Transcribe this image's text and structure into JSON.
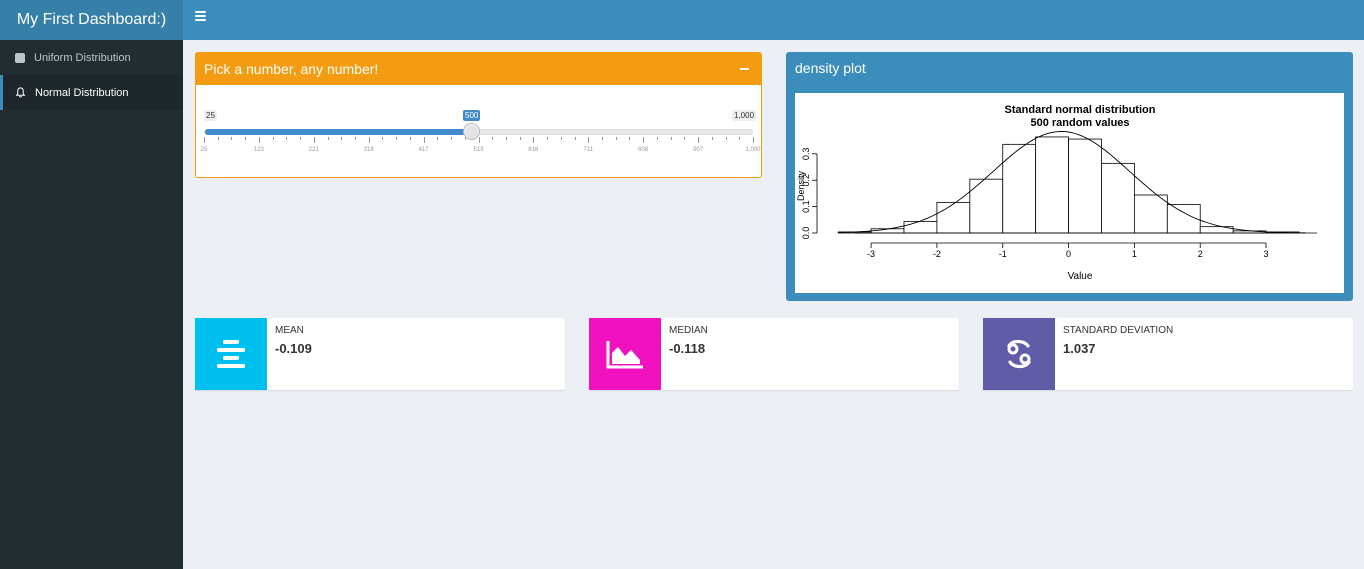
{
  "app": {
    "title": "My First Dashboard:)"
  },
  "sidebar": {
    "items": [
      {
        "label": "Uniform Distribution",
        "icon": "square-icon"
      },
      {
        "label": "Normal Distribution",
        "icon": "bell-icon"
      }
    ]
  },
  "slider_box": {
    "title": "Pick a number, any number!",
    "min_label": "25",
    "max_label": "1,000",
    "value_label": "500",
    "value": 500,
    "min": 25,
    "max": 1000,
    "tick_labels": [
      "25",
      "123",
      "221",
      "318",
      "417",
      "513",
      "616",
      "711",
      "808",
      "907",
      "1,000"
    ],
    "color": "#f39c12"
  },
  "plot_box": {
    "title": "density plot",
    "color": "#3c8dbc"
  },
  "chart_data": {
    "type": "bar",
    "title": "Standard normal distribution",
    "subtitle": "500 random values",
    "xlabel": "Value",
    "ylabel": "Density",
    "xlim": [
      -3.7,
      3.85
    ],
    "ylim": [
      0,
      0.36
    ],
    "x_ticks": [
      -3,
      -2,
      -1,
      0,
      1,
      2,
      3
    ],
    "y_ticks": [
      0.0,
      0.1,
      0.2,
      0.3
    ],
    "bins": [
      {
        "from": -3.5,
        "to": -3.0,
        "density": 0.004
      },
      {
        "from": -3.0,
        "to": -2.5,
        "density": 0.016
      },
      {
        "from": -2.5,
        "to": -2.0,
        "density": 0.044
      },
      {
        "from": -2.0,
        "to": -1.5,
        "density": 0.116
      },
      {
        "from": -1.5,
        "to": -1.0,
        "density": 0.204
      },
      {
        "from": -1.0,
        "to": -0.5,
        "density": 0.336
      },
      {
        "from": -0.5,
        "to": 0.0,
        "density": 0.364
      },
      {
        "from": 0.0,
        "to": 0.5,
        "density": 0.356
      },
      {
        "from": 0.5,
        "to": 1.0,
        "density": 0.264
      },
      {
        "from": 1.0,
        "to": 1.5,
        "density": 0.144
      },
      {
        "from": 1.5,
        "to": 2.0,
        "density": 0.108
      },
      {
        "from": 2.0,
        "to": 2.5,
        "density": 0.024
      },
      {
        "from": 2.5,
        "to": 3.0,
        "density": 0.008
      },
      {
        "from": 3.0,
        "to": 3.5,
        "density": 0.004
      }
    ],
    "density_curve": "normal, mean -0.109, sd 1.037"
  },
  "stats": [
    {
      "label": "MEAN",
      "value": "-0.109",
      "color": "#00c0ef",
      "icon": "align-center-icon"
    },
    {
      "label": "MEDIAN",
      "value": "-0.118",
      "color": "#f012be",
      "icon": "area-chart-icon"
    },
    {
      "label": "STANDARD DEVIATION",
      "value": "1.037",
      "color": "#605ca8",
      "icon": "cancer-sign-icon"
    }
  ]
}
